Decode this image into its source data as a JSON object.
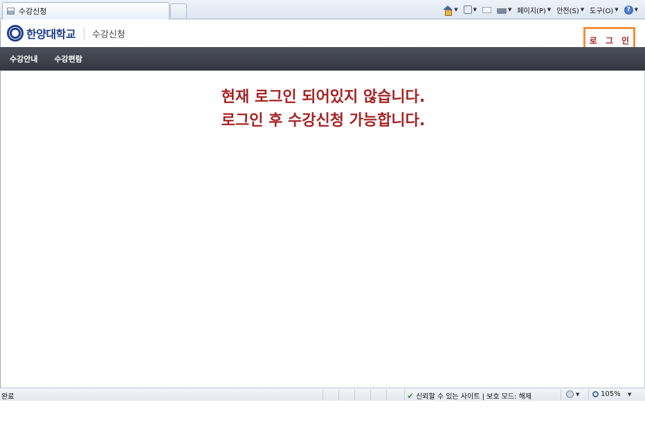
{
  "browser": {
    "tab_title": "수강신청",
    "commands": {
      "page": "페이지(P)",
      "safety": "안전(S)",
      "tools": "도구(O)"
    }
  },
  "header": {
    "university": "한양대학교",
    "section_title": "수강신청",
    "login_label": "로 그 인"
  },
  "nav": {
    "items": [
      {
        "label": "수강안내"
      },
      {
        "label": "수강편람"
      }
    ]
  },
  "content": {
    "notice_line1": "현재 로그인 되어있지 않습니다.",
    "notice_line2": "로그인 후 수강신청 가능합니다."
  },
  "status_bar": {
    "status": "완료",
    "zone": "신뢰할 수 있는 사이트 | 보호 모드: 해제",
    "zoom": "105%"
  },
  "colors": {
    "notice_text": "#a62323",
    "nav_background": "#3f424b",
    "login_highlight": "#f0903c",
    "brand_blue": "#1d3d8a"
  }
}
